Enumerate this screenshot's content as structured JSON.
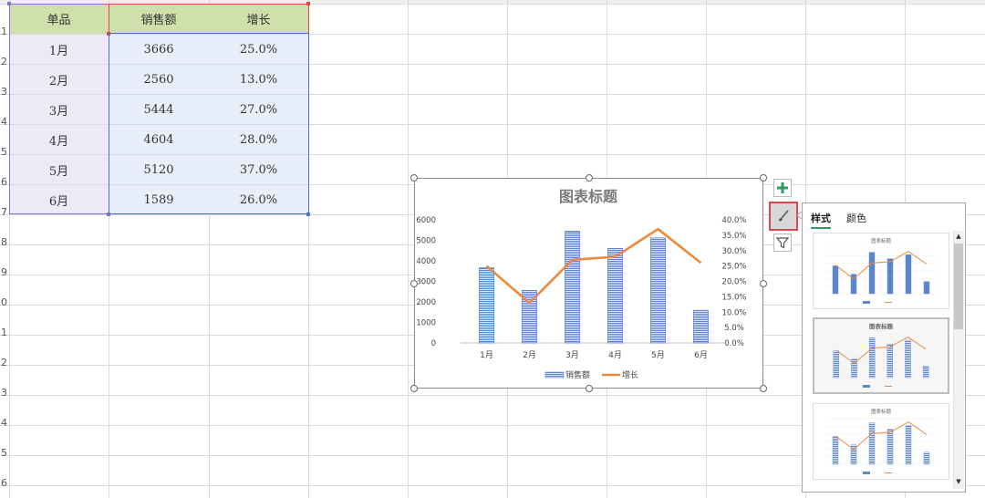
{
  "table": {
    "headers": [
      "单品",
      "销售额",
      "增长"
    ],
    "rows": [
      [
        "1月",
        "3666",
        "25.0%"
      ],
      [
        "2月",
        "2560",
        "13.0%"
      ],
      [
        "3月",
        "5444",
        "27.0%"
      ],
      [
        "4月",
        "4604",
        "28.0%"
      ],
      [
        "5月",
        "5120",
        "37.0%"
      ],
      [
        "6月",
        "1589",
        "26.0%"
      ]
    ]
  },
  "row_numbers": [
    "1",
    "2",
    "3",
    "4",
    "5",
    "6",
    "7",
    "8",
    "9",
    "0",
    "1",
    "2",
    "3",
    "4",
    "5",
    "6"
  ],
  "chart_data": {
    "type": "bar",
    "title": "图表标题",
    "categories": [
      "1月",
      "2月",
      "3月",
      "4月",
      "5月",
      "6月"
    ],
    "series": [
      {
        "name": "销售额",
        "type": "bar",
        "values": [
          3666,
          2560,
          5444,
          4604,
          5120,
          1589
        ],
        "axis": "left"
      },
      {
        "name": "增长",
        "type": "line",
        "values": [
          0.25,
          0.13,
          0.27,
          0.28,
          0.37,
          0.26
        ],
        "axis": "right"
      }
    ],
    "ylim": [
      0,
      6000
    ],
    "yticks": [
      "0",
      "1000",
      "2000",
      "3000",
      "4000",
      "5000",
      "6000"
    ],
    "y2lim": [
      0,
      0.4
    ],
    "y2ticks": [
      "0.0%",
      "5.0%",
      "10.0%",
      "15.0%",
      "20.0%",
      "25.0%",
      "30.0%",
      "35.0%",
      "40.0%"
    ],
    "legend": "bottom",
    "grid": false,
    "colors": {
      "bar": "#5b86cf",
      "line": "#ec8a3a"
    }
  },
  "side_buttons": {
    "add_icon": "plus-icon",
    "style_icon": "brush-icon",
    "filter_icon": "funnel-icon"
  },
  "style_panel": {
    "tabs": [
      "样式",
      "颜色"
    ],
    "active_tab": "样式",
    "thumb_title": "图表标题"
  },
  "colors": {
    "header_fill": "#cfe0ad",
    "band_a": "#ede9f6",
    "band_b": "#e8eefa",
    "accent_green": "#2e9960",
    "selection_red": "#e0454b"
  }
}
